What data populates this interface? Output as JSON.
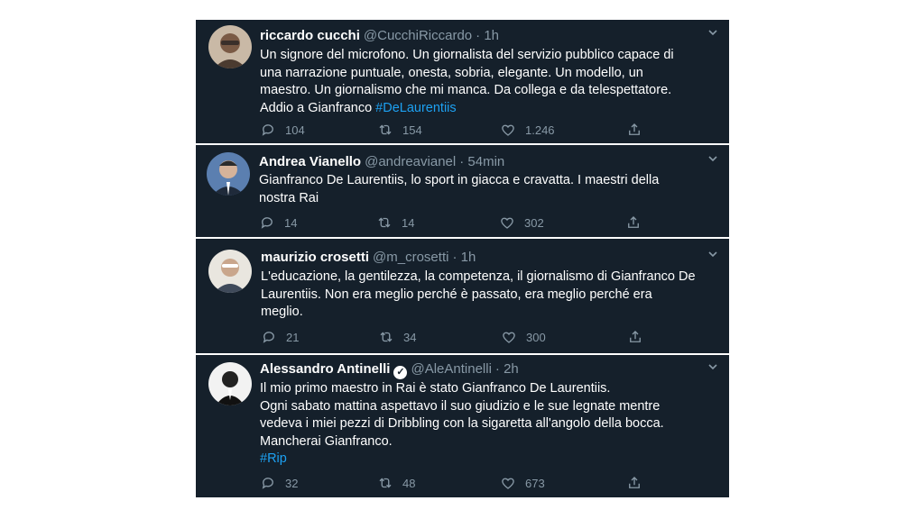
{
  "tweets": [
    {
      "name": "riccardo cucchi",
      "handle": "@CucchiRiccardo",
      "time": "· 1h",
      "text": "Un signore del microfono. Un giornalista del servizio pubblico capace di\nuna narrazione puntuale, onesta, sobria, elegante. Un modello, un\nmaestro. Un giornalismo che mi manca. Da collega e da telespettatore.\nAddio a Gianfranco ",
      "hashtag": "#DeLaurentiis",
      "replies": "104",
      "retweets": "154",
      "likes": "1.246"
    },
    {
      "name": "Andrea Vianello",
      "handle": "@andreavianel",
      "time": "· 54min",
      "text": "Gianfranco De Laurentiis, lo sport in giacca e cravatta. I maestri della\nnostra Rai",
      "hashtag": "",
      "replies": "14",
      "retweets": "14",
      "likes": "302"
    },
    {
      "name": "maurizio crosetti",
      "handle": "@m_crosetti",
      "time": "· 1h",
      "text": "L'educazione, la gentilezza, la competenza, il giornalismo di Gianfranco De\nLaurentiis. Non era meglio perché è passato, era meglio perché era\nmeglio.",
      "hashtag": "",
      "replies": "21",
      "retweets": "34",
      "likes": "300"
    },
    {
      "name": "Alessandro Antinelli",
      "handle": "@AleAntinelli",
      "time": "· 2h",
      "text": "Il mio primo maestro in Rai è stato Gianfranco De Laurentiis.\nOgni sabato mattina aspettavo il suo giudizio e le sue legnate mentre\nvedeva i miei pezzi di Dribbling con la sigaretta all'angolo della bocca.\nMancherai Gianfranco.\n",
      "hashtag": "#Rip",
      "replies": "32",
      "retweets": "48",
      "likes": "673"
    }
  ],
  "icons": {
    "reply": "reply-icon",
    "retweet": "retweet-icon",
    "like": "heart-icon",
    "share": "share-icon",
    "more": "chevron-down-icon",
    "verified": "verified-badge-icon"
  },
  "colors": {
    "background": "#15202b",
    "text": "#ffffff",
    "muted": "#8899a6",
    "link": "#1da1f2"
  }
}
